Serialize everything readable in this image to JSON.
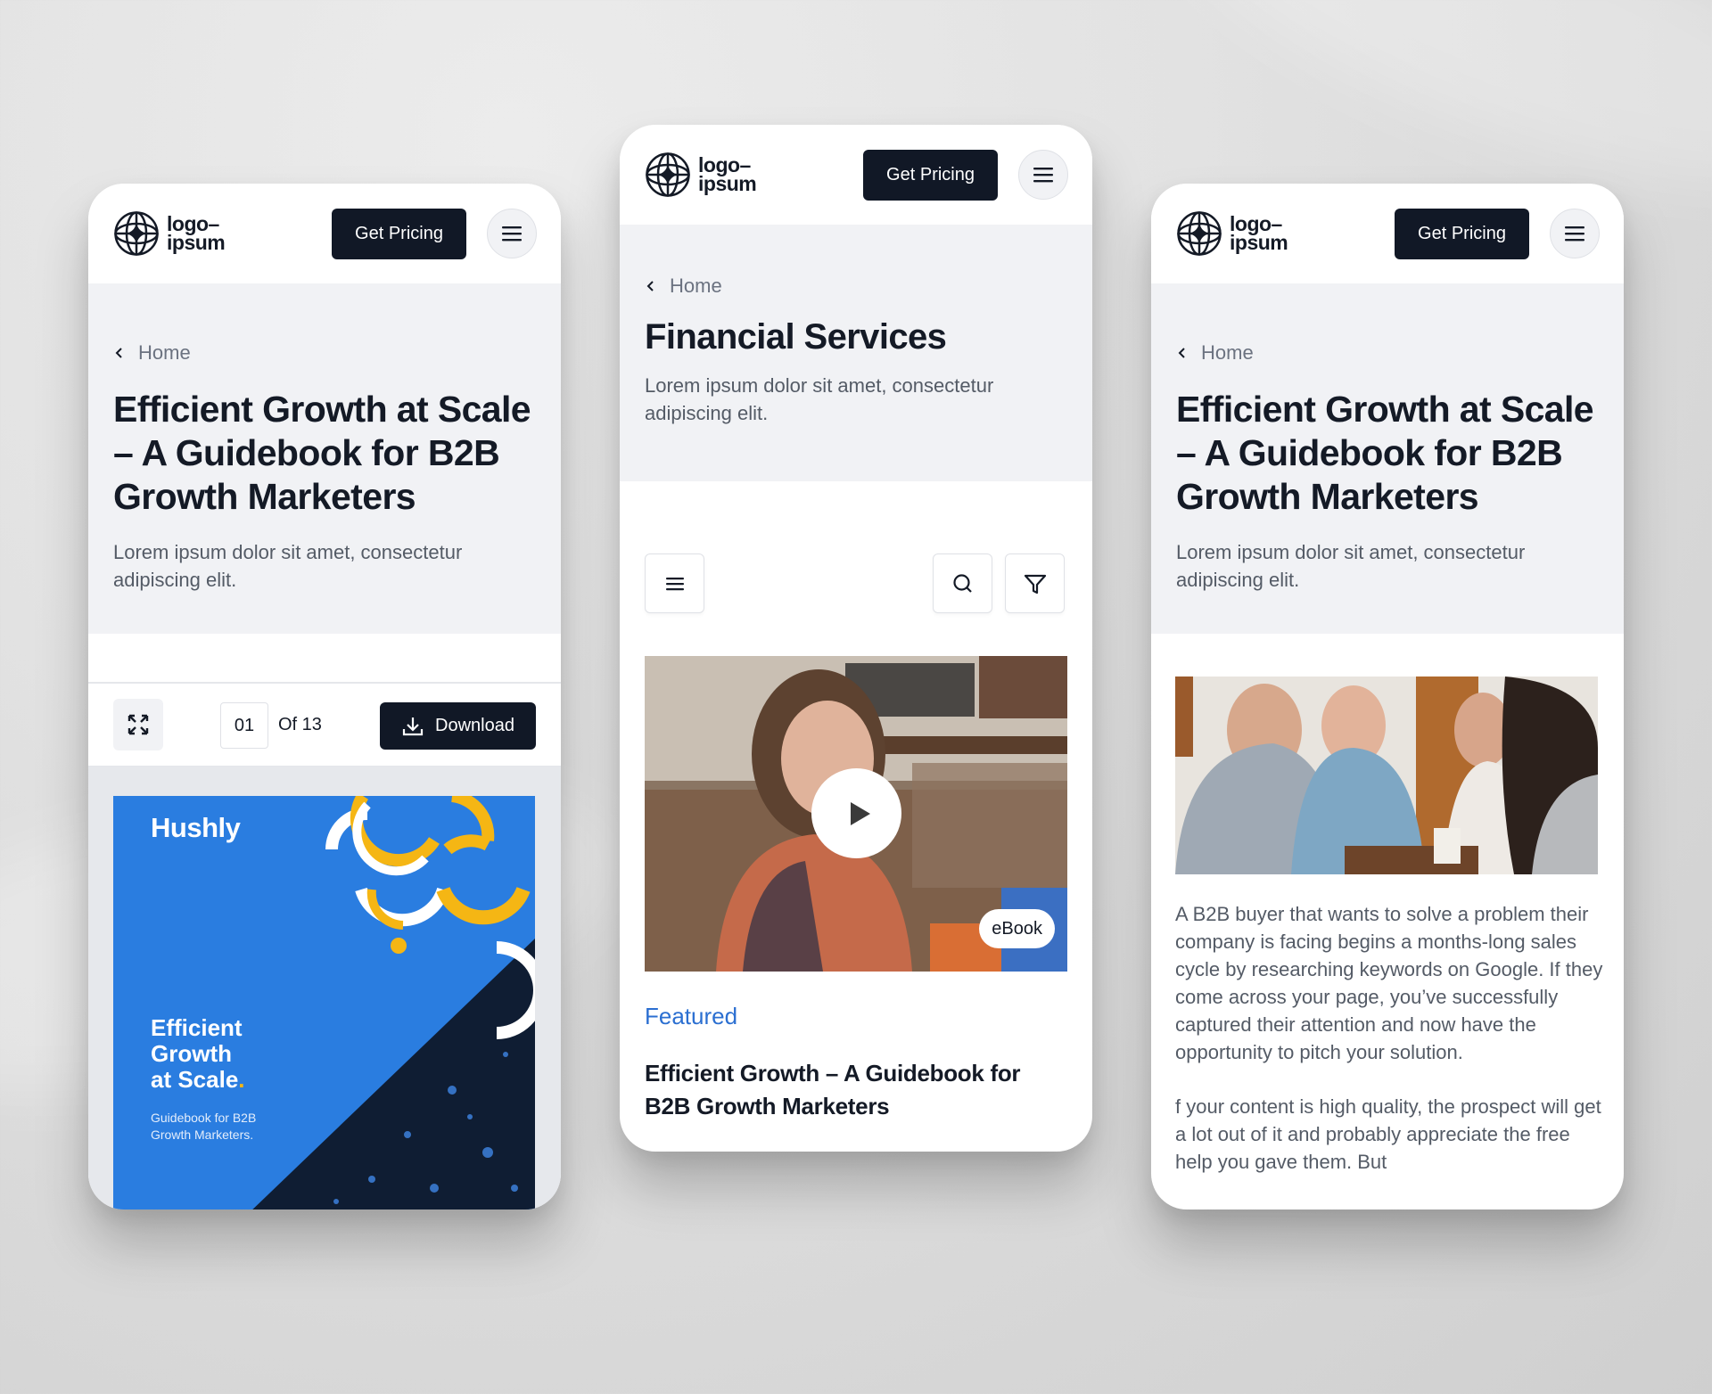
{
  "common": {
    "logo": {
      "line1": "logo–",
      "line2": "ipsum",
      "icon": "globe-star-icon"
    },
    "get_pricing_label": "Get Pricing",
    "menu_icon": "hamburger-menu-icon",
    "breadcrumb_back_label": "Home",
    "hero_subtitle": "Lorem ipsum dolor sit amet, consectetur adipiscing elit."
  },
  "cards": [
    {
      "hero_title": "Efficient Growth at Scale – A Guidebook for B2B Growth Marketers",
      "viewer": {
        "expand_icon": "expand-icon",
        "current_page": "01",
        "page_total_label": "Of 13",
        "download_label": "Download",
        "download_icon": "download-icon"
      },
      "ebook_cover": {
        "brand": "Hushly",
        "title_lines": [
          "Efficient",
          "Growth",
          "at Scale"
        ],
        "title_dot": ".",
        "subtitle": "Guidebook for B2B Growth Marketers.",
        "colors": {
          "blue": "#2a7de0",
          "yellow": "#f5b614",
          "navy": "#0f1d33"
        }
      }
    },
    {
      "hero_title": "Financial Services",
      "toolbar": {
        "menu_icon": "list-menu-icon",
        "search_icon": "search-icon",
        "filter_icon": "filter-icon"
      },
      "featured": {
        "badge": "eBook",
        "play_icon": "play-icon",
        "label": "Featured",
        "title": "Efficient Growth – A Guidebook for B2B Growth Marketers",
        "label_color": "#2b6fd1"
      }
    },
    {
      "hero_title": "Efficient Growth at Scale – A Guidebook for B2B Growth Marketers",
      "article": {
        "paragraphs": [
          "A B2B buyer that wants to solve a problem their company is facing begins a months-long sales cycle by researching keywords on Google. If they come across your page, you’ve successfully captured their attention and now have the opportunity to pitch your solution.",
          "f your content is high quality, the prospect will get a lot out of it and probably appreciate the free help you gave them. But"
        ]
      }
    }
  ],
  "colors": {
    "primary_dark": "#111826",
    "hero_bg": "#f1f2f5",
    "text_dark": "#141a26",
    "text_muted": "#545b66"
  }
}
